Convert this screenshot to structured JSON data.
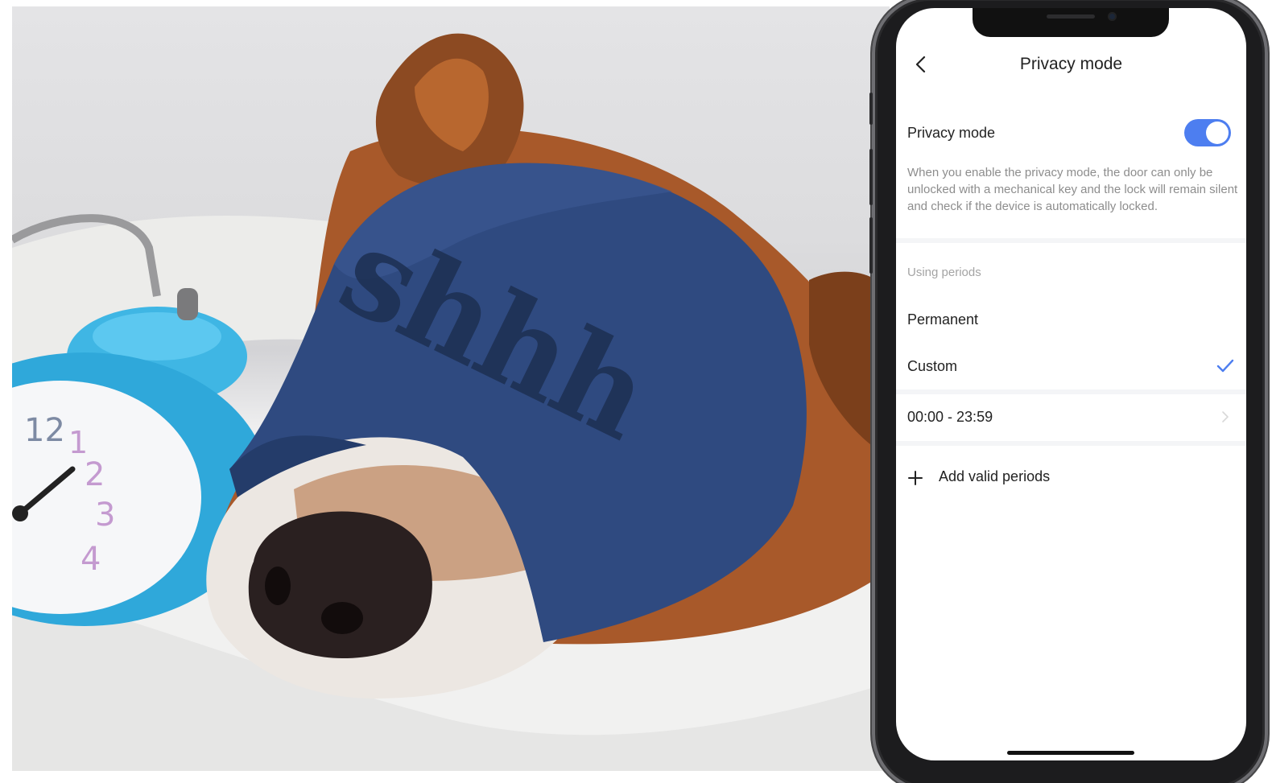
{
  "photo": {
    "mask_text": "shhh",
    "clock_numbers": [
      "12",
      "1",
      "2",
      "3",
      "4"
    ]
  },
  "screen": {
    "title": "Privacy mode",
    "privacy_toggle": {
      "label": "Privacy mode",
      "enabled": true
    },
    "description": "When you enable the privacy mode, the door can only be unlocked with a mechanical key and the lock will remain silent and check if the device is automatically locked.",
    "using_periods": {
      "section_label": "Using periods",
      "options": [
        {
          "label": "Permanent",
          "selected": false
        },
        {
          "label": "Custom",
          "selected": true
        }
      ]
    },
    "time_period": "00:00 - 23:59",
    "add_periods_label": "Add valid periods"
  },
  "colors": {
    "accent": "#4d7ef0",
    "text_primary": "#222222",
    "text_secondary": "#8d8d8d",
    "section_label": "#a4a4a4",
    "separator": "#f4f5f7",
    "mask_blue": "#2f4a80",
    "clock_blue": "#3fb6e4",
    "dog_brown": "#a8592a"
  },
  "icons": {
    "back": "chevron-left-icon",
    "check": "checkmark-icon",
    "forward": "chevron-right-icon",
    "add": "plus-icon"
  }
}
